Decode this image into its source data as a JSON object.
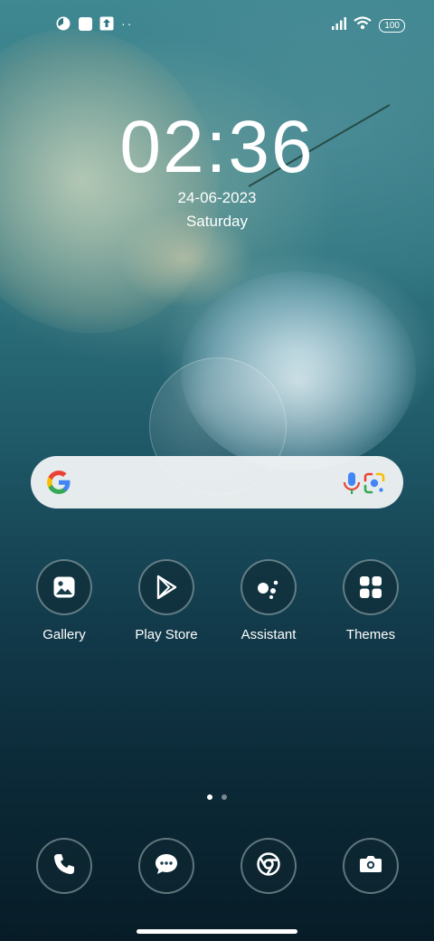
{
  "status_bar": {
    "left_icons": [
      "pie-chart-icon",
      "square-app-icon",
      "upload-icon",
      "more-dots-icon"
    ],
    "more_dots": "··",
    "right_icons": [
      "signal-icon",
      "wifi-icon",
      "battery-icon"
    ],
    "battery_level": "100"
  },
  "lock": {
    "time": "02:36",
    "date": "24-06-2023",
    "weekday": "Saturday"
  },
  "search_bar": {
    "icons": [
      "google-g-icon",
      "mic-icon",
      "google-lens-icon"
    ]
  },
  "apps": [
    {
      "label": "Gallery",
      "icon": "gallery-icon"
    },
    {
      "label": "Play Store",
      "icon": "play-store-icon"
    },
    {
      "label": "Assistant",
      "icon": "assistant-icon"
    },
    {
      "label": "Themes",
      "icon": "themes-grid-icon"
    }
  ],
  "pager": {
    "pages": 2,
    "active_page": 1
  },
  "dock": [
    {
      "icon": "phone-icon"
    },
    {
      "icon": "messages-icon"
    },
    {
      "icon": "chrome-icon"
    },
    {
      "icon": "camera-icon"
    }
  ],
  "colors": {
    "google_blue": "#4285F4",
    "google_red": "#EA4335",
    "google_yellow": "#FBBC05",
    "google_green": "#34A853"
  }
}
